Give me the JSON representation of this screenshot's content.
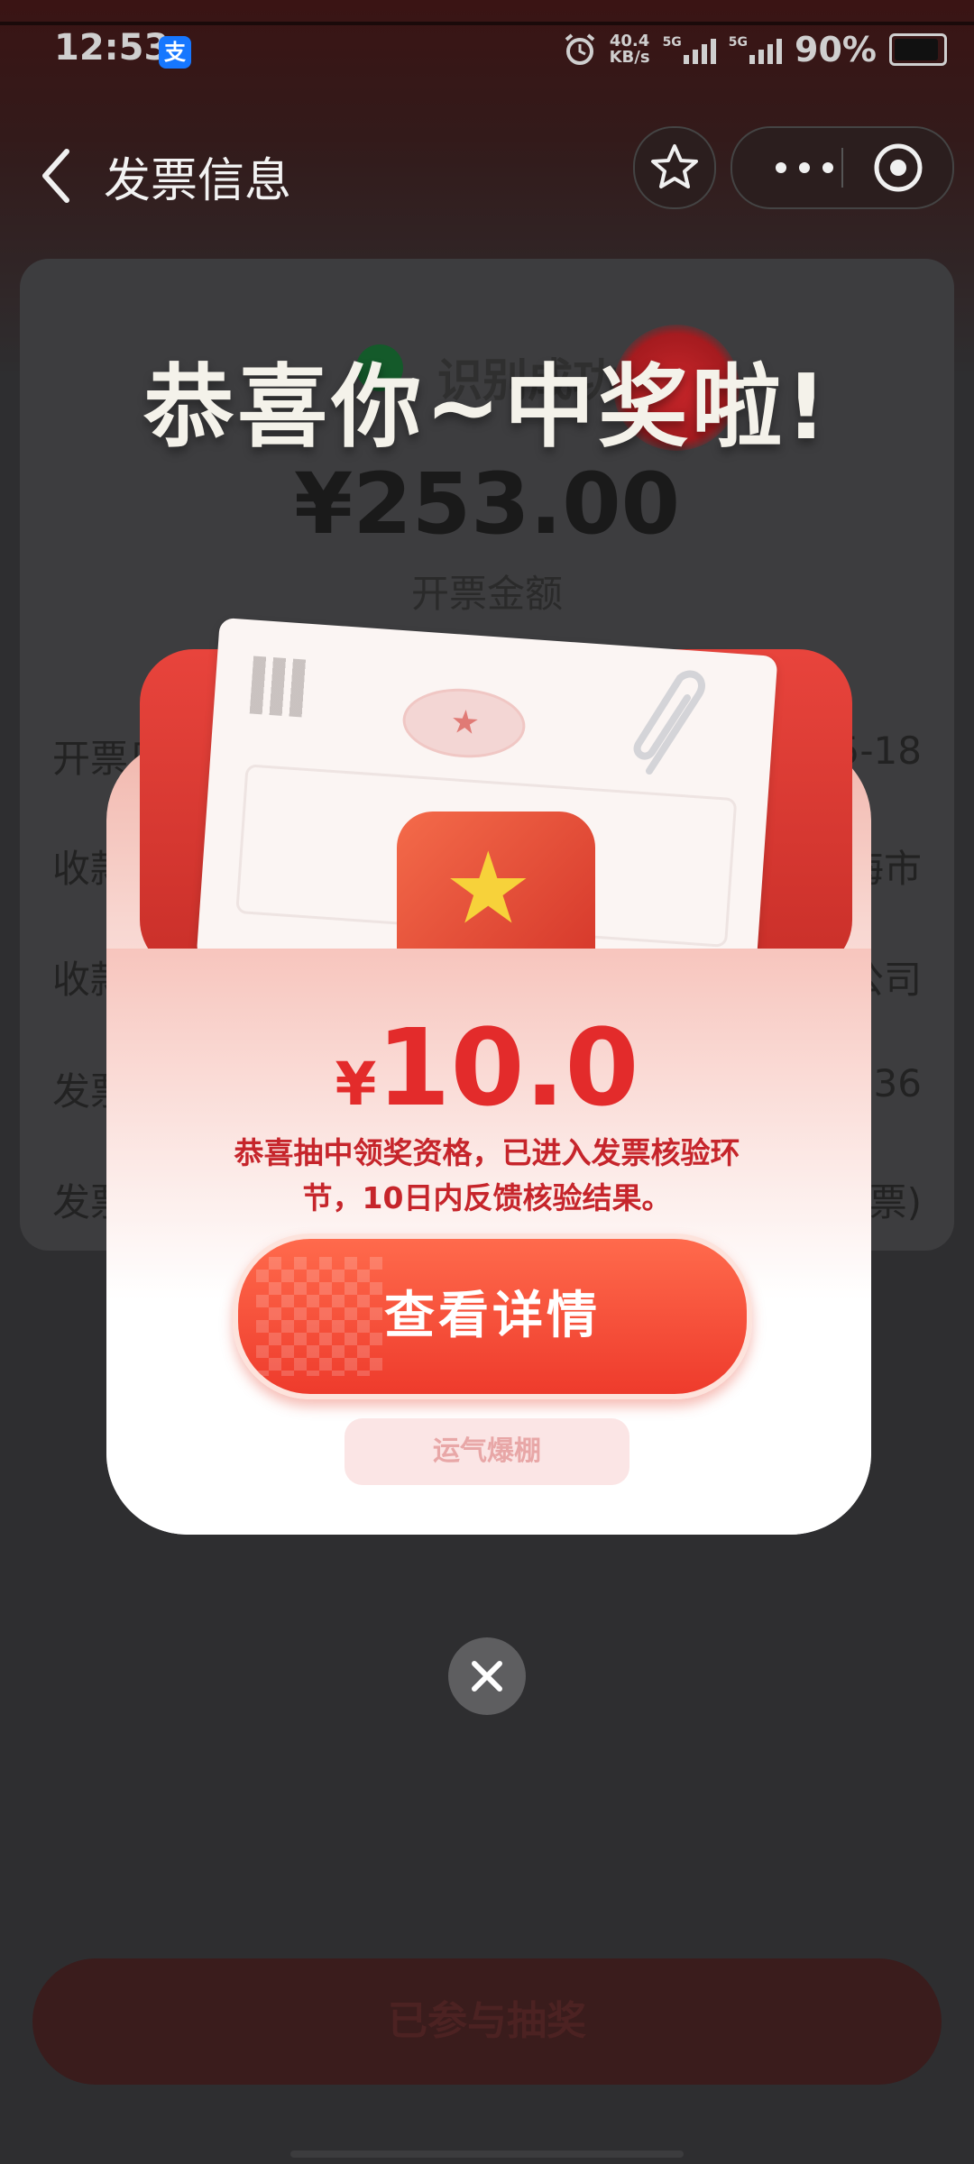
{
  "status_bar": {
    "time": "12:53",
    "app_badge": "支",
    "net_speed_value": "40.4",
    "net_speed_unit": "KB/s",
    "sim1_label": "5G",
    "sim2_label": "5G",
    "battery_percent": "90%"
  },
  "nav": {
    "title": "发票信息"
  },
  "card": {
    "status": "识别成功",
    "amount": "¥253.00",
    "amount_label": "开票金额",
    "rows": [
      {
        "label": "开票日",
        "value": "5-18"
      },
      {
        "label": "收款",
        "value": "海市"
      },
      {
        "label": "收款",
        "value": "公司"
      },
      {
        "label": "发票",
        "value": "336"
      },
      {
        "label": "发票",
        "value": "票)"
      }
    ]
  },
  "bottom": {
    "joined_label": "已参与抽奖"
  },
  "modal": {
    "headline": "恭喜你~中奖啦!",
    "prize_currency": "¥",
    "prize_amount": "10.0",
    "message": "恭喜抽中领奖资格，已进入发票核验环节，10日内反馈核验结果。",
    "cta_label": "查看详情",
    "tag_label": "运气爆棚"
  },
  "colors": {
    "accent_red": "#ee3b2c",
    "message_red": "#c6252b",
    "prize_red": "#e32b2b"
  },
  "icons": [
    "back-arrow-icon",
    "star-icon",
    "more-dots-icon",
    "target-icon",
    "close-icon",
    "alarm-icon",
    "signal-icon",
    "battery-icon"
  ]
}
